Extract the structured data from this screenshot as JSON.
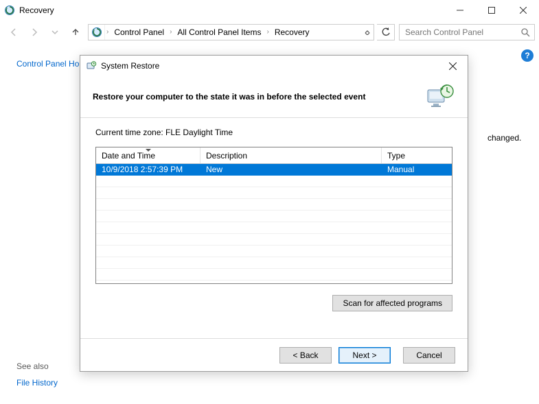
{
  "window": {
    "title": "Recovery",
    "minimize_tip": "Minimize",
    "maximize_tip": "Maximize",
    "close_tip": "Close"
  },
  "breadcrumbs": [
    "Control Panel",
    "All Control Panel Items",
    "Recovery"
  ],
  "search": {
    "placeholder": "Search Control Panel"
  },
  "left_panel": {
    "home_link": "Control Panel Ho",
    "see_also": "See also",
    "file_history": "File History"
  },
  "background_fragment": "changed.",
  "help_badge": "?",
  "dialog": {
    "title": "System Restore",
    "heading": "Restore your computer to the state it was in before the selected event",
    "timezone_line": "Current time zone: FLE Daylight Time",
    "columns": {
      "datetime": "Date and Time",
      "description": "Description",
      "type": "Type"
    },
    "rows": [
      {
        "datetime": "10/9/2018 2:57:39 PM",
        "description": "New",
        "type": "Manual",
        "selected": true
      }
    ],
    "scan_button": "Scan for affected programs",
    "back": "< Back",
    "next": "Next >",
    "cancel": "Cancel"
  }
}
